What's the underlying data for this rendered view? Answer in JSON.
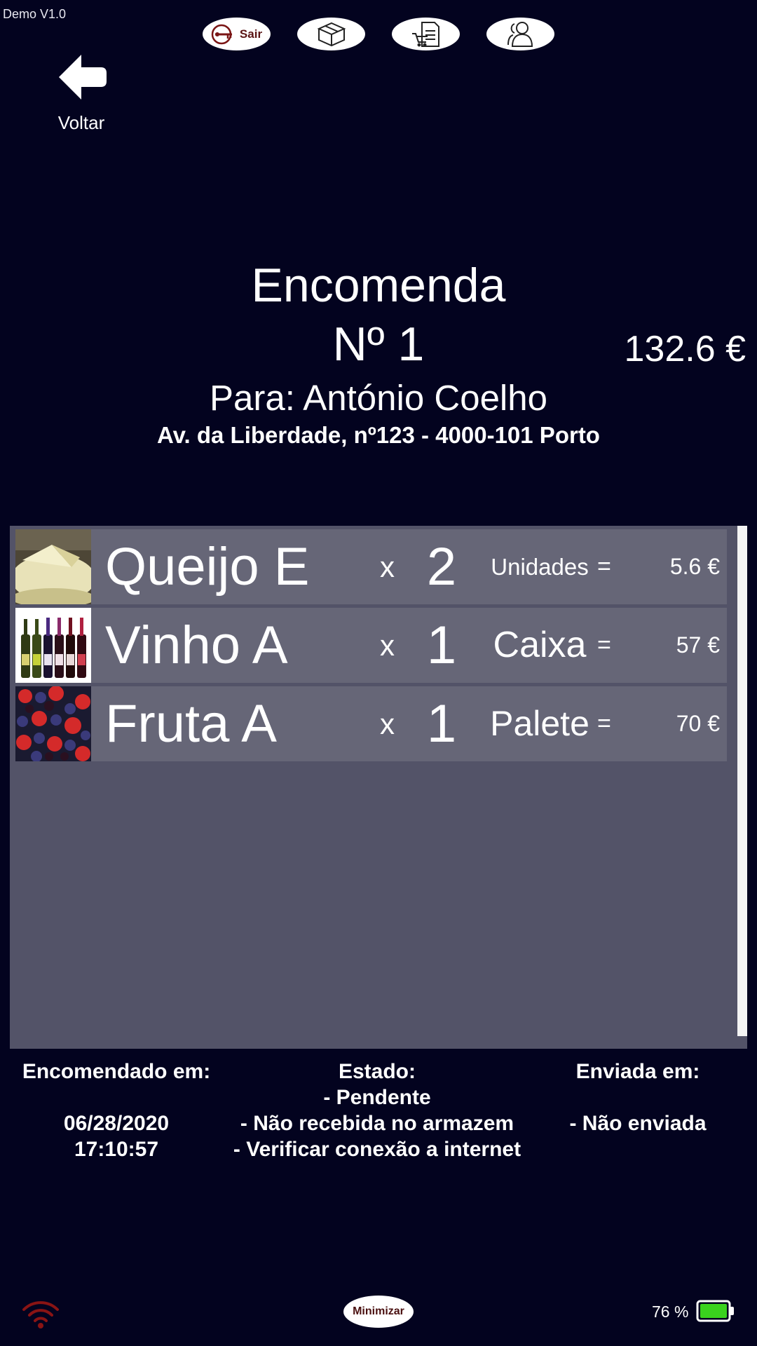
{
  "app": {
    "version": "Demo V1.0"
  },
  "top_bar": {
    "sair_label": "Sair"
  },
  "back": {
    "label": "Voltar"
  },
  "order": {
    "title": "Encomenda",
    "number": "Nº 1",
    "recipient": "Para: António Coelho",
    "address": "Av. da Liberdade, nº123 - 4000-101 Porto",
    "total": "132.6 €"
  },
  "items": [
    {
      "name": "Queijo E",
      "x": "x",
      "qty": "2",
      "unit": "Unidades",
      "eq": "=",
      "price": "5.6 €",
      "image": "cheese-image"
    },
    {
      "name": "Vinho A",
      "x": "x",
      "qty": "1",
      "unit": "Caixa",
      "eq": "=",
      "price": "57 €",
      "image": "wine-bottles-image"
    },
    {
      "name": "Fruta A",
      "x": "x",
      "qty": "1",
      "unit": "Palete",
      "eq": "=",
      "price": "70 €",
      "image": "berries-image"
    }
  ],
  "info": {
    "ordered_label": "Encomendado em:",
    "ordered_date": "06/28/2020",
    "ordered_time": "17:10:57",
    "status_label": "Estado:",
    "status_lines": [
      "- Pendente",
      "- Não recebida no armazem",
      "- Verificar conexão a internet"
    ],
    "sent_label": "Enviada em:",
    "sent_value": "- Não enviada"
  },
  "bottom": {
    "minimize_label": "Minimizar",
    "battery_percent": "76 %"
  },
  "colors": {
    "background": "#03031f",
    "panel": "#535368",
    "row": "#666677",
    "battery_fill": "#3ad21e",
    "wifi": "#8a1414"
  },
  "icons": [
    "key-icon",
    "box-icon",
    "cart-document-icon",
    "users-icon",
    "back-arrow-icon",
    "wifi-icon",
    "battery-icon"
  ]
}
